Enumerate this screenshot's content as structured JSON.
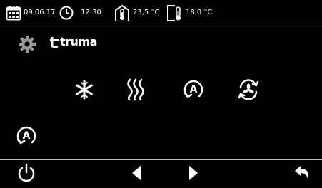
{
  "status": {
    "date": "09.06.17",
    "time": "12:30",
    "inside_temp": "23,5 °C",
    "outside_temp": "18,0 °C",
    "icons": [
      "calendar-icon",
      "clock-icon",
      "indoor-thermometer-icon",
      "outdoor-thermometer-icon"
    ]
  },
  "header": {
    "brand": "truma",
    "icons": [
      "gear-icon",
      "truma-logo"
    ]
  },
  "modes": [
    "cooling-snowflake-icon",
    "heating-waves-icon",
    "auto-mode-icon",
    "ventilation-fan-icon"
  ],
  "current_mode_icon": "auto-mode-icon",
  "nav": [
    "power-icon",
    "arrow-left-icon",
    "arrow-right-icon",
    "back-return-icon"
  ],
  "colors": {
    "background": "#000000",
    "foreground": "#ffffff",
    "separator": "#bdbdbd",
    "gear": "#9a9a9a"
  }
}
